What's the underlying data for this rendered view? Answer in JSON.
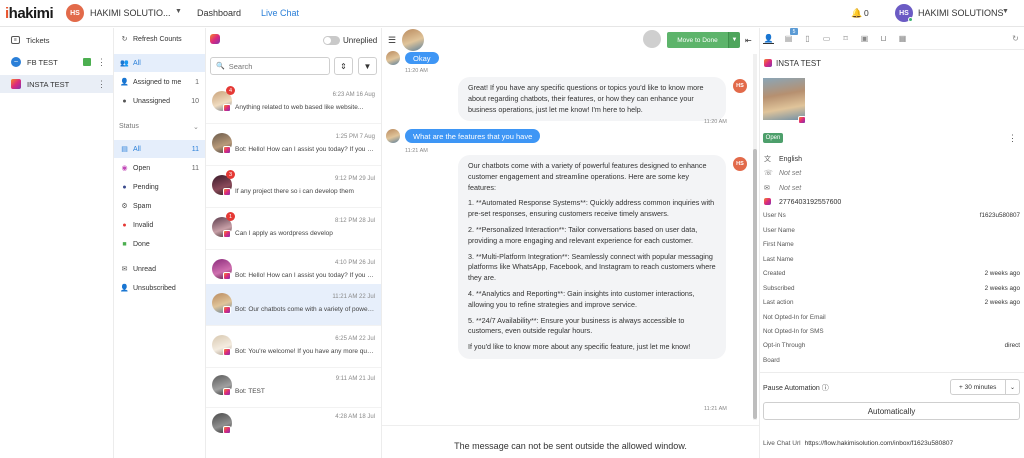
{
  "header": {
    "logo": "hakimi",
    "org_initials": "HS",
    "org_name": "HAKIMI SOLUTIO...",
    "nav": [
      "Dashboard",
      "Live Chat"
    ],
    "notifications": "0",
    "user_initials": "HS",
    "user_name": "HAKIMI SOLUTIONS"
  },
  "channels": [
    {
      "label": "Tickets",
      "icon": "tickets-icon"
    },
    {
      "label": "FB TEST",
      "icon": "messenger-icon"
    },
    {
      "label": "INSTA TEST",
      "icon": "instagram-icon",
      "active": true
    }
  ],
  "filters": {
    "refresh_label": "Refresh Counts",
    "top": [
      {
        "label": "All",
        "count": ""
      },
      {
        "label": "Assigned to me",
        "count": "1"
      },
      {
        "label": "Unassigned",
        "count": "10"
      }
    ],
    "status_label": "Status",
    "status": [
      {
        "label": "All",
        "count": "11"
      },
      {
        "label": "Open",
        "count": "11"
      },
      {
        "label": "Pending",
        "count": ""
      },
      {
        "label": "Spam",
        "count": ""
      },
      {
        "label": "Invalid",
        "count": ""
      },
      {
        "label": "Done",
        "count": ""
      }
    ],
    "bottom": [
      {
        "label": "Unread"
      },
      {
        "label": "Unsubscribed"
      }
    ]
  },
  "conv_list": {
    "unreplied_label": "Unreplied",
    "search_placeholder": "Search",
    "items": [
      {
        "time": "6:23 AM 16 Aug",
        "preview": "Anything related to web based like website...",
        "badge": "4"
      },
      {
        "time": "1:25 PM 7 Aug",
        "preview": "Bot: Hello! How can I assist you today? If you have...",
        "badge": ""
      },
      {
        "time": "9:12 PM 29 Jul",
        "preview": "If any project there so i can develop them",
        "badge": "3"
      },
      {
        "time": "8:12 PM 28 Jul",
        "preview": "Can I apply as wordpress develop",
        "badge": "1"
      },
      {
        "time": "4:10 PM 26 Jul",
        "preview": "Bot: Hello! How can I assist you today? If you have...",
        "badge": ""
      },
      {
        "time": "11:21 AM 22 Jul",
        "preview": "Bot: Our chatbots come with a variety of powerfu...",
        "badge": ""
      },
      {
        "time": "6:25 AM 22 Jul",
        "preview": "Bot: You're welcome! If you have any more questi...",
        "badge": ""
      },
      {
        "time": "9:11 AM 21 Jul",
        "preview": "Bot: TEST",
        "badge": ""
      },
      {
        "time": "4:28 AM 18 Jul",
        "preview": "",
        "badge": ""
      }
    ]
  },
  "chat": {
    "move_to_done": "Move to Done",
    "messages": [
      {
        "type": "in",
        "text": "Okay",
        "time": "11:20 AM"
      },
      {
        "type": "out",
        "initials": "HS",
        "paras": [
          "Great! If you have any specific questions or topics you'd like to know more about regarding chatbots, their features, or how they can enhance your business operations, just let me know! I'm here to help."
        ],
        "time": "11:20 AM"
      },
      {
        "type": "in",
        "text": "What are the features that you have",
        "time": "11:21 AM"
      },
      {
        "type": "out",
        "initials": "HS",
        "paras": [
          "Our chatbots come with a variety of powerful features designed to enhance customer engagement and streamline operations. Here are some key features:",
          "1. **Automated Response Systems**: Quickly address common inquiries with pre-set responses, ensuring customers receive timely answers.",
          "2. **Personalized Interaction**: Tailor conversations based on user data, providing a more engaging and relevant experience for each customer.",
          "3. **Multi-Platform Integration**: Seamlessly connect with popular messaging platforms like WhatsApp, Facebook, and Instagram to reach customers where they are.",
          "4. **Analytics and Reporting**: Gain insights into customer interactions, allowing you to refine strategies and improve service.",
          "5. **24/7 Availability**: Ensure your business is always accessible to customers, even outside regular hours.",
          "If you'd like to know more about any specific feature, just let me know!"
        ],
        "time": "11:21 AM"
      }
    ],
    "footer": "The message can not be sent outside the allowed window."
  },
  "profile": {
    "tab_badge": "5",
    "name": "INSTA TEST",
    "status": "Open",
    "language": "English",
    "phone": "Not set",
    "email": "Not set",
    "ig_id": "2776403192557600",
    "fields": [
      {
        "label": "User Ns",
        "value": "f1623u580807"
      },
      {
        "label": "User Name",
        "value": ""
      },
      {
        "label": "First Name",
        "value": ""
      },
      {
        "label": "Last Name",
        "value": ""
      },
      {
        "label": "Created",
        "value": "2 weeks ago"
      },
      {
        "label": "Subscribed",
        "value": "2 weeks ago"
      },
      {
        "label": "Last action",
        "value": "2 weeks ago"
      },
      {
        "label": "Not Opted-In for Email",
        "value": ""
      },
      {
        "label": "Not Opted-In for SMS",
        "value": ""
      },
      {
        "label": "Opt-in Through",
        "value": "direct"
      },
      {
        "label": "Board",
        "value": ""
      }
    ],
    "pause_label": "Pause Automation",
    "pause_value": "+ 30 minutes",
    "automatically": "Automatically",
    "live_chat_label": "Live Chat Url",
    "live_chat_url": "https://flow.hakimisolution.com/inbox/f1623u580807"
  },
  "colors": {
    "accent": "#2a7fd8",
    "green": "#5db46b",
    "brand": "#e8542e",
    "bubble_in": "#3e96f5"
  }
}
